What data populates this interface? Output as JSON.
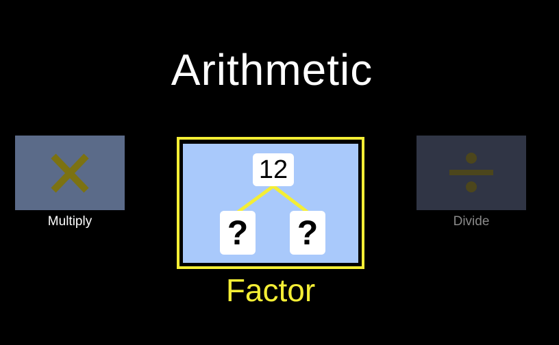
{
  "title": "Arithmetic",
  "tiles": [
    {
      "id": "multiply",
      "label": "Multiply",
      "icon": "multiply-icon",
      "selected": false,
      "enabled": true
    },
    {
      "id": "factor",
      "label": "Factor",
      "icon": "factor-tree-icon",
      "selected": true,
      "enabled": true,
      "tree": {
        "root": "12",
        "left": "?",
        "right": "?"
      }
    },
    {
      "id": "divide",
      "label": "Divide",
      "icon": "divide-icon",
      "selected": false,
      "enabled": false
    }
  ],
  "colors": {
    "background": "#000000",
    "highlight": "#f4ee35",
    "multiply_tile": "#5b6b89",
    "factor_tile": "#a9c9fb",
    "divide_tile": "#303545",
    "icon_olive": "#7c7212",
    "icon_dim": "#4c461c"
  }
}
